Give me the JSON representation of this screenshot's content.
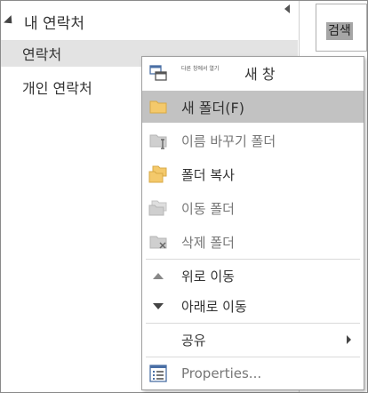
{
  "nav": {
    "group_title": "내 연락처",
    "items": [
      {
        "label": "연락처",
        "selected": true
      },
      {
        "label": "개인 연락처",
        "selected": false
      }
    ]
  },
  "search": {
    "label": "검색"
  },
  "menu": {
    "items": [
      {
        "label": "새 창",
        "sub_label": "다른 창에서 열기",
        "icon": "new-window-icon"
      },
      {
        "label": "새 폴더(F)",
        "icon": "new-folder-icon",
        "highlighted": true
      },
      {
        "label": "이름 바꾸기 폴더",
        "icon": "rename-folder-icon"
      },
      {
        "label": "폴더 복사",
        "icon": "copy-folder-icon"
      },
      {
        "label": "이동 폴더",
        "icon": "move-folder-icon"
      },
      {
        "label": "삭제 폴더",
        "icon": "delete-folder-icon"
      },
      {
        "label": "위로 이동",
        "icon": "move-up-icon"
      },
      {
        "label": "아래로 이동",
        "icon": "move-down-icon"
      },
      {
        "label": "공유",
        "icon": "",
        "has_submenu": true
      },
      {
        "label": "Properties...",
        "icon": "properties-icon"
      }
    ]
  },
  "colors": {
    "highlight": "#c2c2c2",
    "selected_nav": "#e3e3e3",
    "folder_yellow": "#f4c96b",
    "folder_gray": "#cfcfcf"
  }
}
